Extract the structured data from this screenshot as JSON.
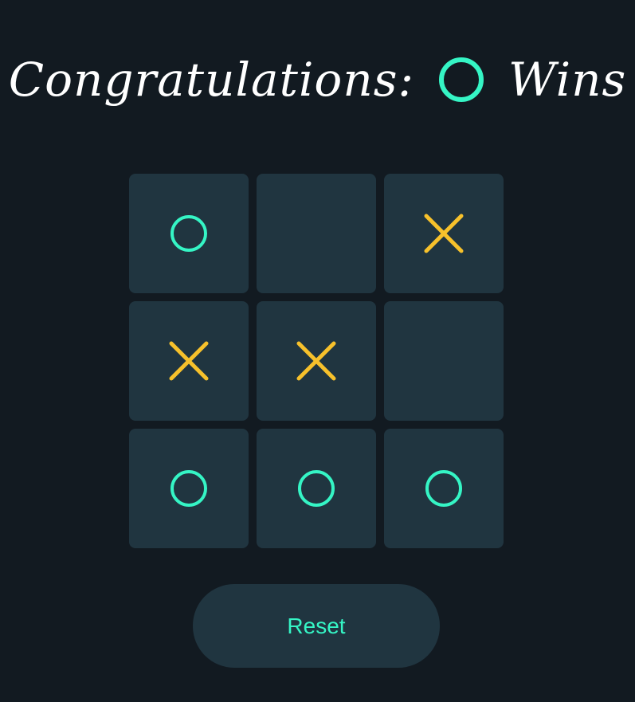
{
  "header": {
    "prefix": "Congratulations:",
    "winner_mark": "O",
    "suffix": "Wins"
  },
  "board": {
    "cells": [
      "O",
      "",
      "X",
      "X",
      "X",
      "",
      "O",
      "O",
      "O"
    ]
  },
  "reset": {
    "label": "Reset"
  },
  "colors": {
    "background": "#121a21",
    "cell": "#203540",
    "o_mark": "#35f5c5",
    "x_mark": "#f7c12b",
    "title_text": "#ffffff",
    "reset_text": "#35f5c5"
  }
}
